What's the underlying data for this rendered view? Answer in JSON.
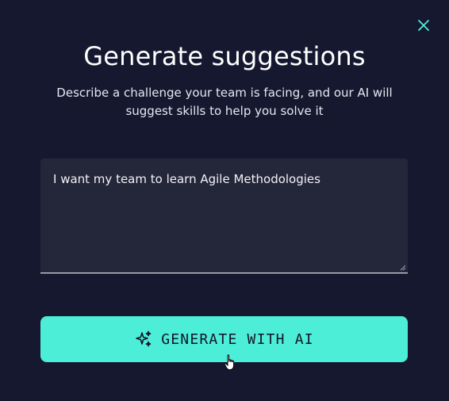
{
  "dialog": {
    "title": "Generate suggestions",
    "subtitle": "Describe a challenge your team is facing, and our AI will suggest skills to help you solve it",
    "input": {
      "value": "I want my team to learn Agile Methodologies"
    },
    "generate_button": {
      "label": "GENERATE WITH AI",
      "icon": "sparkles-icon"
    },
    "close_icon": "close-icon"
  },
  "colors": {
    "background": "#161830",
    "input_background": "#242639",
    "accent": "#4deed8",
    "button_text": "#131527"
  }
}
